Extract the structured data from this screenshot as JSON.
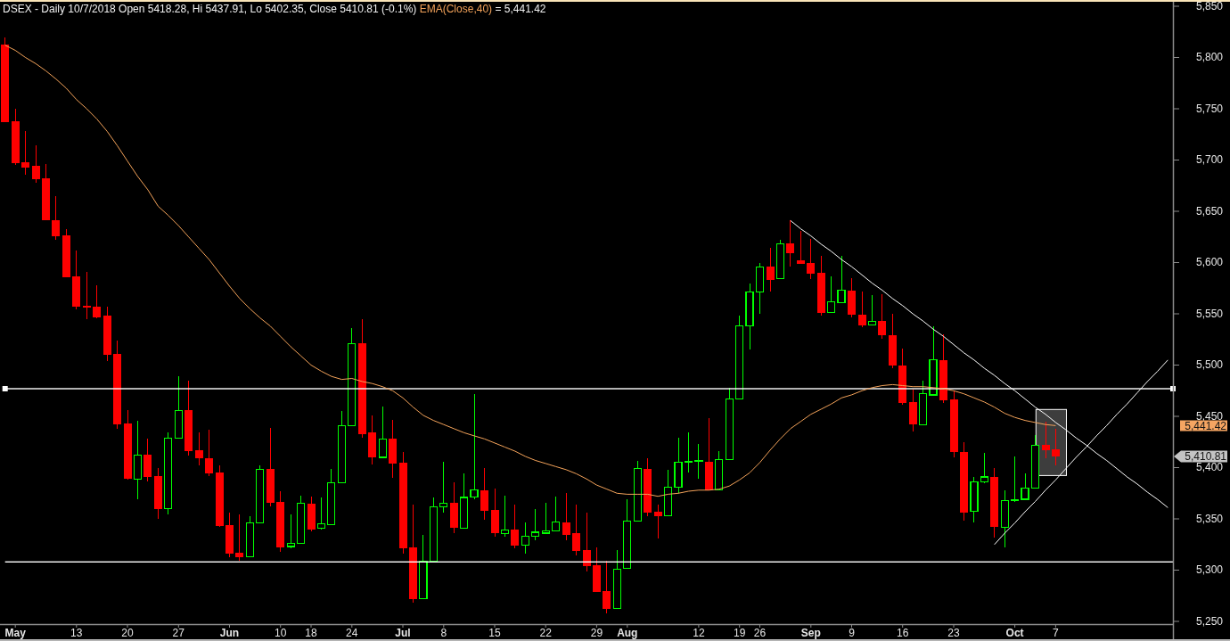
{
  "chart": {
    "chart_data": {
      "type": "candlestick",
      "title": "DSEX - Daily 10/7/2018 Open 5418.28, Hi 5437.91, Lo 5402.35, Close 5410.81 (-0.1%)",
      "categories": [
        null,
        "May",
        null,
        null,
        null,
        null,
        null,
        "13",
        null,
        null,
        null,
        null,
        "20",
        null,
        null,
        null,
        null,
        "27",
        null,
        null,
        null,
        null,
        "Jun",
        null,
        null,
        null,
        null,
        "10",
        null,
        null,
        "18",
        null,
        null,
        null,
        "24",
        null,
        null,
        null,
        null,
        "Jul",
        null,
        null,
        null,
        "8",
        null,
        null,
        null,
        null,
        "15",
        null,
        null,
        null,
        null,
        "22",
        null,
        null,
        null,
        null,
        "29",
        null,
        null,
        "Aug",
        null,
        null,
        null,
        null,
        null,
        null,
        "12",
        null,
        null,
        null,
        "19",
        null,
        "26",
        null,
        null,
        null,
        null,
        "Sep",
        null,
        null,
        null,
        "9",
        null,
        null,
        null,
        null,
        "16",
        null,
        null,
        null,
        null,
        "23",
        null,
        null,
        null,
        null,
        null,
        "Oct",
        null,
        null,
        null,
        "7",
        null,
        null,
        null,
        null,
        null,
        null,
        null,
        null,
        null,
        null,
        null
      ],
      "ohlc": [
        [
          5813,
          5820,
          5737,
          5737
        ],
        [
          5738,
          5750,
          5695,
          5697
        ],
        [
          5698,
          5728,
          5686,
          5693
        ],
        [
          5694,
          5714,
          5678,
          5681
        ],
        [
          5682,
          5696,
          5641,
          5641
        ],
        [
          5641,
          5665,
          5622,
          5626
        ],
        [
          5627,
          5633,
          5586,
          5586
        ],
        [
          5587,
          5612,
          5554,
          5557
        ],
        [
          5558,
          5591,
          5545,
          5556
        ],
        [
          5557,
          5578,
          5546,
          5547
        ],
        [
          5548,
          5557,
          5504,
          5510
        ],
        [
          5511,
          5524,
          5438,
          5442
        ],
        [
          5443,
          5456,
          5388,
          5389
        ],
        [
          5389,
          5446,
          5369,
          5412
        ],
        [
          5413,
          5428,
          5387,
          5391
        ],
        [
          5392,
          5400,
          5350,
          5360
        ],
        [
          5360,
          5434,
          5354,
          5429
        ],
        [
          5429,
          5489,
          5429,
          5456
        ],
        [
          5456,
          5485,
          5412,
          5416
        ],
        [
          5417,
          5434,
          5402,
          5409
        ],
        [
          5409,
          5437,
          5392,
          5394
        ],
        [
          5395,
          5402,
          5342,
          5343
        ],
        [
          5344,
          5356,
          5313,
          5316
        ],
        [
          5317,
          5354,
          5309,
          5313
        ],
        [
          5313,
          5353,
          5313,
          5346
        ],
        [
          5346,
          5402,
          5346,
          5398
        ],
        [
          5399,
          5439,
          5362,
          5366
        ],
        [
          5367,
          5377,
          5318,
          5322
        ],
        [
          5323,
          5354,
          5321,
          5326
        ],
        [
          5326,
          5373,
          5326,
          5365
        ],
        [
          5365,
          5372,
          5338,
          5340
        ],
        [
          5341,
          5371,
          5340,
          5345
        ],
        [
          5344,
          5399,
          5344,
          5385
        ],
        [
          5385,
          5455,
          5385,
          5441
        ],
        [
          5441,
          5536,
          5441,
          5521
        ],
        [
          5521,
          5545,
          5429,
          5433
        ],
        [
          5434,
          5451,
          5403,
          5410
        ],
        [
          5410,
          5460,
          5410,
          5428
        ],
        [
          5428,
          5447,
          5390,
          5404
        ],
        [
          5405,
          5415,
          5316,
          5321
        ],
        [
          5322,
          5364,
          5268,
          5272
        ],
        [
          5272,
          5334,
          5272,
          5309
        ],
        [
          5309,
          5371,
          5309,
          5362
        ],
        [
          5362,
          5406,
          5356,
          5365
        ],
        [
          5366,
          5386,
          5336,
          5341
        ],
        [
          5341,
          5394,
          5341,
          5371
        ],
        [
          5371,
          5472,
          5369,
          5378
        ],
        [
          5378,
          5400,
          5349,
          5358
        ],
        [
          5359,
          5380,
          5333,
          5336
        ],
        [
          5336,
          5373,
          5333,
          5339
        ],
        [
          5340,
          5364,
          5321,
          5324
        ],
        [
          5324,
          5347,
          5316,
          5333
        ],
        [
          5333,
          5360,
          5329,
          5337
        ],
        [
          5336,
          5366,
          5336,
          5338
        ],
        [
          5338,
          5372,
          5338,
          5347
        ],
        [
          5347,
          5375,
          5329,
          5334
        ],
        [
          5336,
          5364,
          5314,
          5319
        ],
        [
          5320,
          5356,
          5299,
          5304
        ],
        [
          5305,
          5322,
          5279,
          5279
        ],
        [
          5280,
          5309,
          5258,
          5262
        ],
        [
          5263,
          5320,
          5263,
          5301
        ],
        [
          5302,
          5369,
          5302,
          5348
        ],
        [
          5348,
          5407,
          5348,
          5399
        ],
        [
          5399,
          5409,
          5353,
          5356
        ],
        [
          5357,
          5364,
          5331,
          5353
        ],
        [
          5353,
          5398,
          5353,
          5381
        ],
        [
          5381,
          5429,
          5375,
          5405
        ],
        [
          5405,
          5434,
          5395,
          5406
        ],
        [
          5406,
          5423,
          5389,
          5407
        ],
        [
          5406,
          5448,
          5378,
          5378
        ],
        [
          5378,
          5416,
          5378,
          5408
        ],
        [
          5408,
          5478,
          5408,
          5467
        ],
        [
          5467,
          5548,
          5467,
          5538
        ],
        [
          5538,
          5580,
          5515,
          5571
        ],
        [
          5571,
          5600,
          5550,
          5596
        ],
        [
          5596,
          5614,
          5572,
          5583
        ],
        [
          5584,
          5622,
          5584,
          5618
        ],
        [
          5619,
          5641,
          5596,
          5609
        ],
        [
          5602,
          5631,
          5599,
          5599
        ],
        [
          5600,
          5623,
          5584,
          5589
        ],
        [
          5590,
          5607,
          5548,
          5551
        ],
        [
          5551,
          5587,
          5551,
          5562
        ],
        [
          5561,
          5607,
          5561,
          5573
        ],
        [
          5573,
          5585,
          5547,
          5549
        ],
        [
          5549,
          5572,
          5537,
          5539
        ],
        [
          5539,
          5568,
          5539,
          5543
        ],
        [
          5543,
          5569,
          5526,
          5529
        ],
        [
          5529,
          5550,
          5497,
          5500
        ],
        [
          5500,
          5516,
          5461,
          5463
        ],
        [
          5464,
          5476,
          5435,
          5442
        ],
        [
          5442,
          5485,
          5442,
          5472
        ],
        [
          5471,
          5538,
          5471,
          5505
        ],
        [
          5505,
          5530,
          5463,
          5466
        ],
        [
          5467,
          5475,
          5410,
          5415
        ],
        [
          5415,
          5425,
          5348,
          5356
        ],
        [
          5357,
          5391,
          5347,
          5386
        ],
        [
          5386,
          5414,
          5385,
          5391
        ],
        [
          5391,
          5400,
          5332,
          5342
        ],
        [
          5342,
          5378,
          5322,
          5368
        ],
        [
          5368,
          5411,
          5367,
          5369
        ],
        [
          5369,
          5394,
          5369,
          5380
        ],
        [
          5380,
          5432,
          5380,
          5422
        ],
        [
          5422,
          5445,
          5409,
          5417
        ],
        [
          5418,
          5438,
          5402,
          5411
        ],
        null,
        null,
        null,
        null,
        null,
        null,
        null,
        null,
        null,
        null,
        null
      ],
      "series": [
        {
          "name": "EMA(Close,40)",
          "type": "line",
          "color": "#f4a35a",
          "values": [
            5812,
            5807,
            5800,
            5794,
            5787,
            5779,
            5770,
            5759,
            5750,
            5740,
            5728,
            5714,
            5699,
            5684,
            5671,
            5655,
            5646,
            5636,
            5625,
            5614,
            5603,
            5590,
            5577,
            5565,
            5555,
            5546,
            5538,
            5528,
            5518,
            5509,
            5500,
            5494,
            5489,
            5486,
            5487,
            5484,
            5482,
            5479,
            5475,
            5468,
            5459,
            5451,
            5446,
            5442,
            5438,
            5434,
            5431,
            5428,
            5424,
            5420,
            5416,
            5411,
            5407,
            5404,
            5401,
            5398,
            5394,
            5389,
            5383,
            5379,
            5375,
            5374,
            5374,
            5374,
            5372,
            5374,
            5375,
            5377,
            5378,
            5378,
            5379,
            5382,
            5388,
            5395,
            5405,
            5417,
            5428,
            5438,
            5445,
            5452,
            5457,
            5462,
            5468,
            5471,
            5475,
            5478,
            5480,
            5481,
            5480,
            5479,
            5479,
            5478,
            5477,
            5475,
            5472,
            5468,
            5464,
            5459,
            5453,
            5449,
            5446,
            5444,
            5442,
            5441,
            null,
            null,
            null,
            null,
            null,
            null,
            null,
            null,
            null,
            null,
            null
          ]
        },
        {
          "type": "line",
          "color": "#ffffff",
          "values": [
            null,
            null,
            null,
            null,
            null,
            null,
            null,
            null,
            null,
            null,
            null,
            null,
            null,
            null,
            null,
            null,
            null,
            null,
            null,
            null,
            null,
            null,
            null,
            null,
            null,
            null,
            null,
            null,
            null,
            null,
            null,
            null,
            null,
            null,
            null,
            null,
            null,
            null,
            null,
            null,
            null,
            null,
            null,
            null,
            null,
            null,
            null,
            null,
            null,
            null,
            null,
            null,
            null,
            null,
            null,
            null,
            null,
            null,
            null,
            null,
            null,
            null,
            null,
            null,
            null,
            null,
            null,
            null,
            null,
            null,
            null,
            null,
            null,
            null,
            null,
            null,
            null,
            5641,
            5633,
            5626,
            5618,
            5611,
            5603,
            5596,
            5588,
            5580,
            5573,
            5565,
            5558,
            5550,
            5543,
            5535,
            5528,
            5520,
            5512,
            5505,
            5497,
            5490,
            5482,
            5475,
            5467,
            5459,
            5452,
            5444,
            5437,
            5429,
            5422,
            5414,
            5407,
            5399,
            5391,
            5384,
            5376,
            5369,
            5361
          ]
        },
        {
          "type": "line",
          "color": "#ffffff",
          "values": [
            null,
            null,
            null,
            null,
            null,
            null,
            null,
            null,
            null,
            null,
            null,
            null,
            null,
            null,
            null,
            null,
            null,
            null,
            null,
            null,
            null,
            null,
            null,
            null,
            null,
            null,
            null,
            null,
            null,
            null,
            null,
            null,
            null,
            null,
            null,
            null,
            null,
            null,
            null,
            null,
            null,
            null,
            null,
            null,
            null,
            null,
            null,
            null,
            null,
            null,
            null,
            null,
            null,
            null,
            null,
            null,
            null,
            null,
            null,
            null,
            null,
            null,
            null,
            null,
            null,
            null,
            null,
            null,
            null,
            null,
            null,
            null,
            null,
            null,
            null,
            null,
            null,
            null,
            null,
            null,
            null,
            null,
            null,
            null,
            null,
            null,
            null,
            null,
            null,
            null,
            null,
            null,
            null,
            null,
            null,
            null,
            null,
            5325,
            5336,
            5346,
            5357,
            5367,
            5378,
            5388,
            5399,
            5410,
            5420,
            5431,
            5441,
            5452,
            5462,
            5473,
            5484,
            5494,
            5505
          ]
        }
      ],
      "ylim": [
        5247.4,
        5856.1
      ],
      "yticks": [
        {
          "value": 5250,
          "label": "5,250"
        },
        {
          "value": 5300,
          "label": "5,300"
        },
        {
          "value": 5350,
          "label": "5,350"
        },
        {
          "value": 5400,
          "label": "5,400"
        },
        {
          "value": 5450,
          "label": "5,450"
        },
        {
          "value": 5500,
          "label": "5,500"
        },
        {
          "value": 5550,
          "label": "5,550"
        },
        {
          "value": 5600,
          "label": "5,600"
        },
        {
          "value": 5650,
          "label": "5,650"
        },
        {
          "value": 5700,
          "label": "5,700"
        },
        {
          "value": 5750,
          "label": "5,750"
        },
        {
          "value": 5800,
          "label": "5,800"
        },
        {
          "value": 5850,
          "label": "5,850"
        }
      ],
      "ref_lines": [
        {
          "axis": "y",
          "value": 5477
        },
        {
          "axis": "y",
          "value": 5308
        }
      ]
    },
    "line_handles": [
      {
        "selected": true
      },
      {
        "selected": false
      }
    ],
    "legend_value": "= 5,441.42",
    "price_labels": [
      {
        "kind": "indicator",
        "color": "#f5a562",
        "text": "5,441.42"
      },
      {
        "kind": "last_price",
        "color": "#c4c4c4",
        "text": "5,410.81"
      }
    ]
  }
}
